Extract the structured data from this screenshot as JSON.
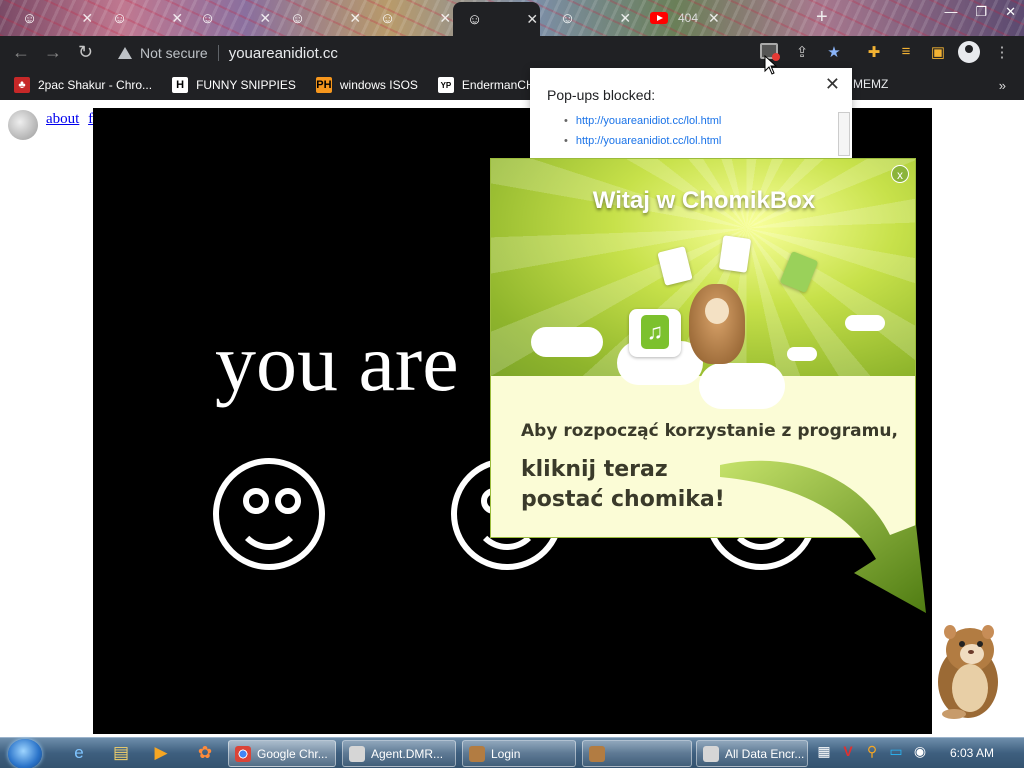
{
  "browser": {
    "tabs": [
      {
        "icon": "smiley-icon",
        "glyph": "☺",
        "close": "✕"
      },
      {
        "icon": "smiley-icon",
        "glyph": "☺",
        "close": "✕"
      },
      {
        "icon": "smiley-icon",
        "glyph": "☺",
        "close": "✕"
      },
      {
        "icon": "smiley-icon",
        "glyph": "☺",
        "close": "✕"
      },
      {
        "icon": "smiley-icon",
        "glyph": "☺",
        "close": "✕"
      },
      {
        "icon": "smiley-icon",
        "glyph": "☺",
        "close": "✕",
        "active": true
      },
      {
        "icon": "smiley-icon",
        "glyph": "☺",
        "close": "✕"
      },
      {
        "icon": "youtube-icon",
        "label": "404",
        "close": "✕"
      }
    ],
    "new_tab": "+",
    "window_controls": {
      "minimize": "—",
      "restore": "❐",
      "close": "✕"
    },
    "nav": {
      "back": "←",
      "forward": "→",
      "reload": "↻"
    },
    "security_label": "Not secure",
    "url": "youareanidiot.cc",
    "bookmarks": [
      {
        "label": "2pac Shakur - Chro...",
        "icon_text": "♣",
        "icon_bg": "#c62828"
      },
      {
        "label": "FUNNY SNIPPIES",
        "icon_text": "H",
        "icon_bg": "#ffffff"
      },
      {
        "label": "windows ISOS",
        "icon_text": "PH",
        "icon_bg": "#f7971d"
      },
      {
        "label": "EndermanCH/Malw",
        "icon_text": "YP",
        "icon_bg": "#ffffff"
      }
    ],
    "bookmark_end_label": "MEMZ",
    "bookmarks_more": "»"
  },
  "popup_blocked": {
    "title": "Pop-ups blocked:",
    "items": [
      "http://youareanidiot.cc/lol.html",
      "http://youareanidiot.cc/lol.html"
    ],
    "close": "✕"
  },
  "page": {
    "links": [
      "about",
      "flash"
    ],
    "main_text": "you are"
  },
  "ad": {
    "title": "Witaj w ChomikBox",
    "close": "x",
    "line1": "Aby rozpocząć korzystanie z programu,",
    "line2a": "kliknij teraz",
    "line2b": "postać chomika!"
  },
  "taskbar": {
    "items": [
      {
        "label": "Google Chr...",
        "icon": "chrome-icon"
      },
      {
        "label": "Agent.DMR...",
        "icon": "window-icon"
      },
      {
        "label": "Login",
        "icon": "hamster-icon"
      },
      {
        "label": "",
        "icon": "hamster-icon"
      },
      {
        "label": "All Data Encr...",
        "icon": "window-icon"
      }
    ],
    "clock": "6:03 AM"
  },
  "colors": {
    "accent": "#8ab4f8",
    "link": "#0000ee",
    "ad_green": "#8fb52c"
  }
}
